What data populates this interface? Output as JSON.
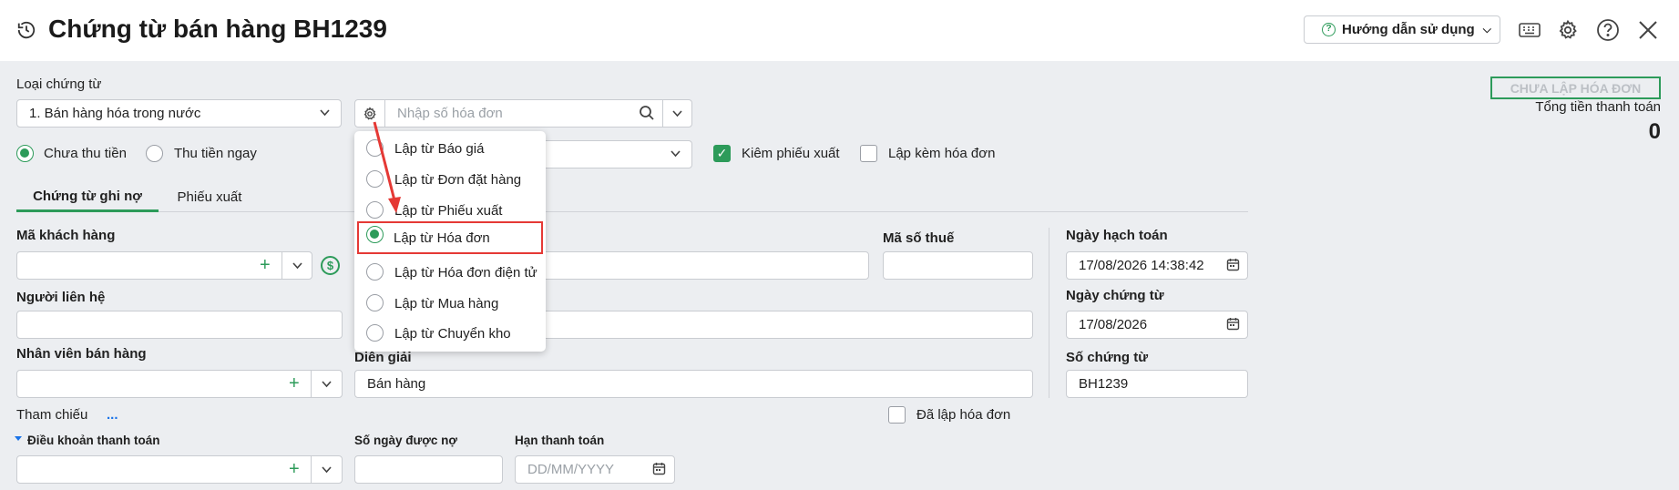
{
  "header": {
    "title": "Chứng từ bán hàng BH1239",
    "help_label": "Hướng dẫn sử dụng"
  },
  "status": {
    "badge": "CHƯA LẬP HÓA ĐƠN",
    "total_label": "Tổng tiền thanh toán",
    "total_value": "0"
  },
  "voucher_type": {
    "label": "Loại chứng từ",
    "value": "1. Bán hàng hóa trong nước"
  },
  "invoice_search": {
    "placeholder": "Nhập số hóa đơn"
  },
  "payment_options": {
    "unpaid": "Chưa thu tiền",
    "paid_now": "Thu tiền ngay",
    "selected": "unpaid"
  },
  "checkboxes": {
    "export_receipt": "Kiêm phiếu xuất",
    "export_receipt_checked": true,
    "with_invoice": "Lập kèm hóa đơn",
    "with_invoice_checked": false,
    "invoiced": "Đã lập hóa đơn",
    "invoiced_checked": false
  },
  "tabs": [
    {
      "label": "Chứng từ ghi nợ",
      "active": true
    },
    {
      "label": "Phiếu xuất",
      "active": false
    }
  ],
  "form": {
    "customer_code": {
      "label": "Mã khách hàng",
      "value": ""
    },
    "tax_code": {
      "label": "Mã số thuế",
      "value": ""
    },
    "contact": {
      "label": "Người liên hệ",
      "value": ""
    },
    "salesperson": {
      "label": "Nhân viên bán hàng",
      "value": ""
    },
    "description": {
      "label": "Diễn giải",
      "value": "Bán hàng"
    },
    "reference": {
      "label": "Tham chiếu",
      "link": "..."
    },
    "payment_terms": {
      "label": "Điều khoản thanh toán",
      "value": ""
    },
    "credit_days": {
      "label": "Số ngày được nợ",
      "value": ""
    },
    "due_date": {
      "label": "Hạn thanh toán",
      "placeholder": "DD/MM/YYYY"
    },
    "posting_date": {
      "label": "Ngày hạch toán",
      "value": "17/08/2026 14:38:42"
    },
    "voucher_date": {
      "label": "Ngày chứng từ",
      "value": "17/08/2026"
    },
    "voucher_no": {
      "label": "Số chứng từ",
      "value": "BH1239"
    }
  },
  "create_from_menu": {
    "items": [
      {
        "label": "Lập từ Báo giá",
        "selected": false
      },
      {
        "label": "Lập từ Đơn đặt hàng",
        "selected": false
      },
      {
        "label": "Lập từ Phiếu xuất",
        "selected": false
      },
      {
        "label": "Lập từ Hóa đơn",
        "selected": true
      },
      {
        "label": "Lập từ Hóa đơn điện tử",
        "selected": false
      },
      {
        "label": "Lập từ Mua hàng",
        "selected": false
      },
      {
        "label": "Lập từ Chuyển kho",
        "selected": false
      }
    ]
  },
  "colors": {
    "accent": "#2d9b5a",
    "highlight": "#e53935"
  }
}
